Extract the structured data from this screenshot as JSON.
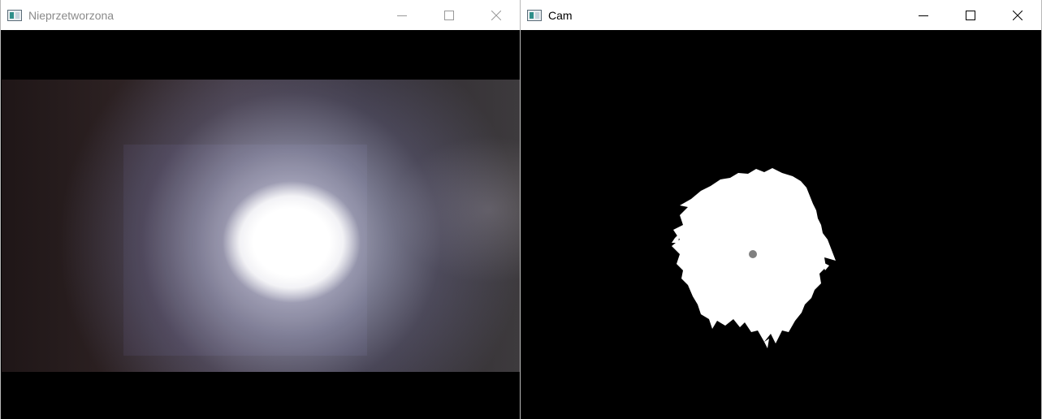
{
  "windows": {
    "left": {
      "title": "Nieprzetworzona"
    },
    "right": {
      "title": "Cam"
    }
  },
  "icons": {
    "app": "opencv-window-icon",
    "minimize": "minimize-icon",
    "maximize": "maximize-icon",
    "close": "close-icon"
  }
}
